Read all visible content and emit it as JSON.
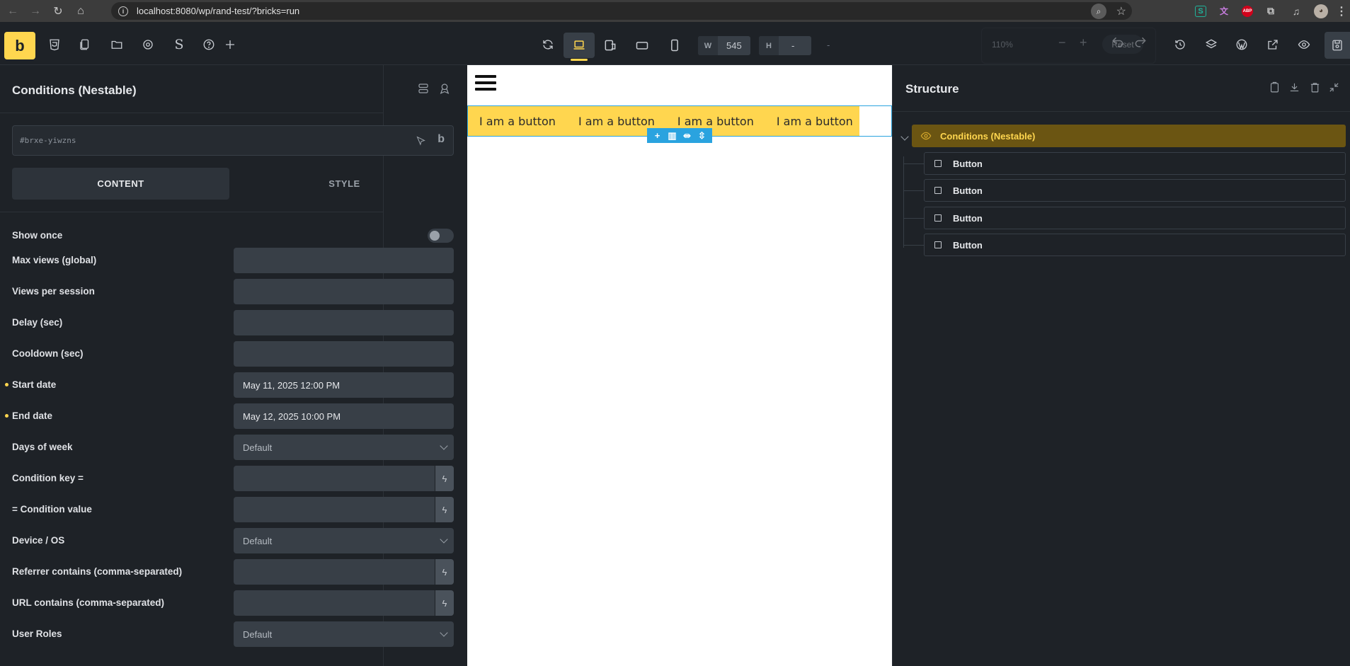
{
  "browser": {
    "url": "localhost:8080/wp/rand-test/?bricks=run",
    "ext_s": "S",
    "ext_abp": "ABP"
  },
  "toolbar": {
    "logo": "b",
    "width_label": "W",
    "width_value": "545",
    "height_label": "H",
    "height_value": "-",
    "dim_separator": "-",
    "zoom_value": "110%",
    "zoom_minus": "−",
    "zoom_plus": "+",
    "zoom_reset": "Reset",
    "accent_color": "#ffd64f"
  },
  "left_panel": {
    "title": "Conditions (Nestable)",
    "element_id": "#brxe-yiwzns",
    "tabs": [
      "CONTENT",
      "STYLE"
    ],
    "active_tab": "CONTENT",
    "fields": [
      {
        "label": "Show once",
        "type": "toggle",
        "value": ""
      },
      {
        "label": "Max views (global)",
        "type": "text",
        "value": ""
      },
      {
        "label": "Views per session",
        "type": "text",
        "value": ""
      },
      {
        "label": "Delay (sec)",
        "type": "text",
        "value": ""
      },
      {
        "label": "Cooldown (sec)",
        "type": "text",
        "value": ""
      },
      {
        "label": "Start date",
        "type": "text",
        "value": "May 11, 2025 12:00 PM",
        "modified": true
      },
      {
        "label": "End date",
        "type": "text",
        "value": "May 12, 2025 10:00 PM",
        "modified": true
      },
      {
        "label": "Days of week",
        "type": "select",
        "value": "Default"
      },
      {
        "label": "Condition key =",
        "type": "dynamic",
        "value": ""
      },
      {
        "label": "= Condition value",
        "type": "dynamic",
        "value": ""
      },
      {
        "label": "Device / OS",
        "type": "select",
        "value": "Default"
      },
      {
        "label": "Referrer contains (comma-separated)",
        "type": "dynamic",
        "value": ""
      },
      {
        "label": "URL contains (comma-separated)",
        "type": "dynamic",
        "value": ""
      },
      {
        "label": "User Roles",
        "type": "select",
        "value": "Default"
      }
    ]
  },
  "canvas": {
    "buttons": [
      "I am a button",
      "I am a button",
      "I am a button",
      "I am a button"
    ],
    "actions": [
      "+",
      "▥",
      "⇹",
      "⇳"
    ]
  },
  "right_panel": {
    "title": "Structure",
    "root": "Conditions (Nestable)",
    "children": [
      "Button",
      "Button",
      "Button",
      "Button"
    ]
  }
}
